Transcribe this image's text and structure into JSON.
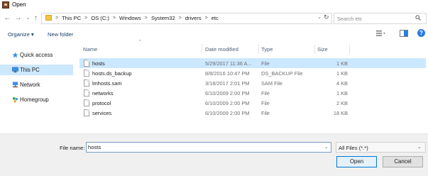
{
  "window": {
    "title": "Open"
  },
  "nav_buttons": {
    "back": "←",
    "forward": "→",
    "up_menu": "⌄",
    "up": "↑"
  },
  "address": {
    "crumbs": [
      "This PC",
      "OS (C:)",
      "Windows",
      "System32",
      "drivers",
      "etc"
    ],
    "separator": ">",
    "dropdown": "⌄",
    "refresh": "↻"
  },
  "search": {
    "placeholder": "Search etc"
  },
  "toolbar": {
    "organize": "Organize ▾",
    "new_folder": "New folder",
    "help": "?"
  },
  "nav_pane": [
    {
      "label": "Quick access",
      "icon": "star-icon"
    },
    {
      "label": "This PC",
      "icon": "computer-icon",
      "selected": true
    },
    {
      "label": "Network",
      "icon": "network-icon"
    },
    {
      "label": "Homegroup",
      "icon": "homegroup-icon"
    }
  ],
  "columns": {
    "name": "Name",
    "date": "Date modified",
    "type": "Type",
    "size": "Size",
    "sort_caret": "^"
  },
  "files": [
    {
      "name": "hosts",
      "date": "5/29/2017 11:36 A...",
      "type": "File",
      "size": "1 KB",
      "selected": true
    },
    {
      "name": "hosts.ds_backup",
      "date": "8/8/2016 10:47 PM",
      "type": "DS_BACKUP File",
      "size": "1 KB"
    },
    {
      "name": "lmhosts.sam",
      "date": "3/18/2017 2:01 PM",
      "type": "SAM File",
      "size": "4 KB"
    },
    {
      "name": "networks",
      "date": "6/10/2009 2:00 PM",
      "type": "File",
      "size": "1 KB"
    },
    {
      "name": "protocol",
      "date": "6/10/2009 2:00 PM",
      "type": "File",
      "size": "2 KB"
    },
    {
      "name": "services",
      "date": "6/10/2009 2:00 PM",
      "type": "File",
      "size": "18 KB"
    }
  ],
  "bottom": {
    "file_name_label": "File name:",
    "file_name_value": "hosts",
    "dropdown": "⌄",
    "filter": "All Files (*.*)",
    "open": "Open",
    "cancel": "Cancel"
  },
  "colors": {
    "selection": "#cce8ff",
    "accent": "#0078d7",
    "link": "#1a3d66"
  }
}
